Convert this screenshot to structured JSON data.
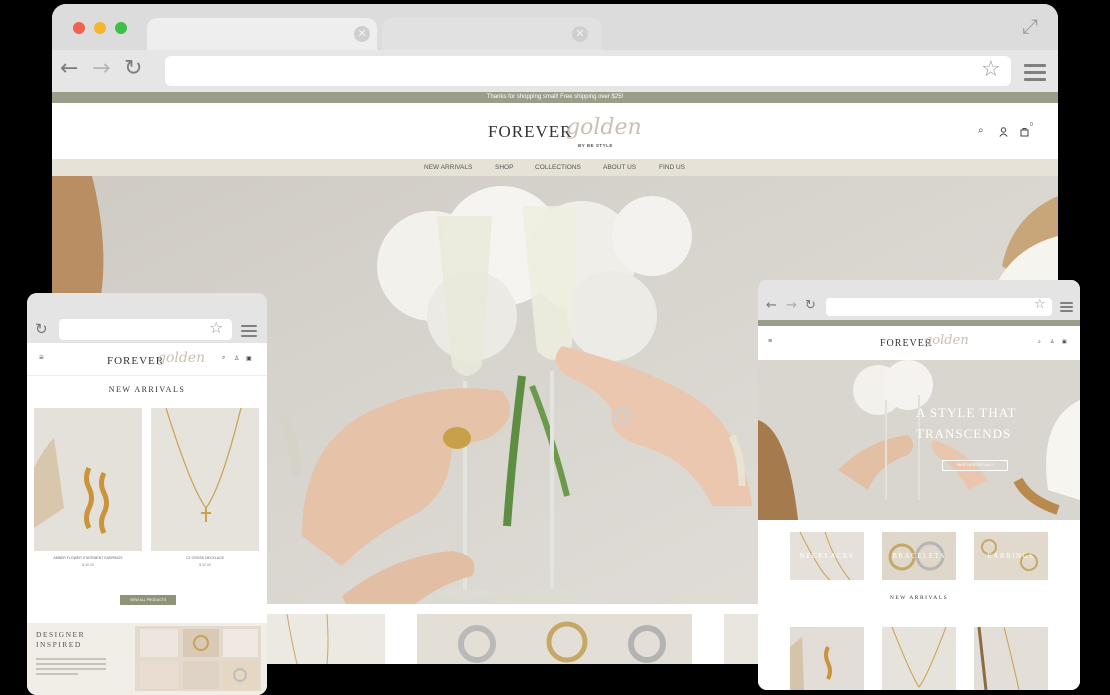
{
  "colors": {
    "accent_olive": "#9b9d88",
    "nav_beige": "#e7e2d7",
    "background": "#000000"
  },
  "desktop": {
    "announcement": "Thanks for shopping small! Free shipping over $25!",
    "logo": {
      "main": "FOREVER",
      "script": "golden",
      "sub": "BY BE STYLE"
    },
    "nav": [
      "NEW ARRIVALS",
      "SHOP",
      "COLLECTIONS",
      "ABOUT US",
      "FIND US"
    ],
    "icons": [
      "search-icon",
      "account-icon",
      "cart-icon"
    ],
    "cart_count": "0"
  },
  "mobile": {
    "logo": {
      "main": "FOREVER",
      "script": "golden"
    },
    "section_title": "NEW ARRIVALS",
    "products": [
      {
        "name": "AMBER FLOWER STATEMENT EARRINGS",
        "price": "$ 40.00"
      },
      {
        "name": "CZ CROSS NECKLACE",
        "price": "$ 32.00"
      }
    ],
    "view_all": "VIEW ALL PRODUCTS",
    "designer": {
      "title_line1": "DESIGNER",
      "title_line2": "INSPIRED"
    }
  },
  "tablet": {
    "logo": {
      "main": "FOREVER",
      "script": "golden"
    },
    "hero_line1": "A STYLE THAT",
    "hero_line2": "TRANSCENDS",
    "hero_button": "SHOP NEW ARRIVALS",
    "categories": [
      "NECKLACES",
      "BRACELETS",
      "EARRINGS"
    ],
    "section_title": "NEW ARRIVALS"
  }
}
